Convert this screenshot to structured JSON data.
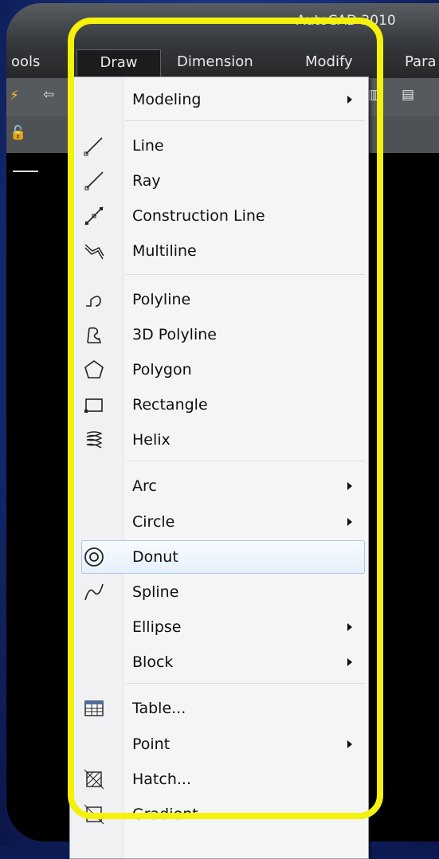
{
  "app": {
    "title": "AutoCAD 2010"
  },
  "menubar": {
    "items": [
      "ools",
      "Draw",
      "Dimension",
      "Modify",
      "Para"
    ],
    "open": "Draw"
  },
  "menu": {
    "items": [
      {
        "label": "Modeling",
        "submenu": true,
        "icon": ""
      },
      {
        "label": "Line",
        "submenu": false,
        "icon": "line-icon"
      },
      {
        "label": "Ray",
        "submenu": false,
        "icon": "ray-icon"
      },
      {
        "label": "Construction Line",
        "submenu": false,
        "icon": "construction-line-icon"
      },
      {
        "label": "Multiline",
        "submenu": false,
        "icon": "multiline-icon"
      },
      {
        "label": "Polyline",
        "submenu": false,
        "icon": "polyline-icon"
      },
      {
        "label": "3D Polyline",
        "submenu": false,
        "icon": "3d-polyline-icon"
      },
      {
        "label": "Polygon",
        "submenu": false,
        "icon": "polygon-icon"
      },
      {
        "label": "Rectangle",
        "submenu": false,
        "icon": "rectangle-icon"
      },
      {
        "label": "Helix",
        "submenu": false,
        "icon": "helix-icon"
      },
      {
        "label": "Arc",
        "submenu": true,
        "icon": ""
      },
      {
        "label": "Circle",
        "submenu": true,
        "icon": ""
      },
      {
        "label": "Donut",
        "submenu": false,
        "icon": "donut-icon",
        "highlighted": true
      },
      {
        "label": "Spline",
        "submenu": false,
        "icon": "spline-icon"
      },
      {
        "label": "Ellipse",
        "submenu": true,
        "icon": ""
      },
      {
        "label": "Block",
        "submenu": true,
        "icon": ""
      },
      {
        "label": "Table...",
        "submenu": false,
        "icon": "table-icon"
      },
      {
        "label": "Point",
        "submenu": true,
        "icon": ""
      },
      {
        "label": "Hatch...",
        "submenu": false,
        "icon": "hatch-icon"
      },
      {
        "label": "Gradient...",
        "submenu": false,
        "icon": "gradient-icon"
      }
    ]
  },
  "colors": {
    "highlight_frame": "#f4f10a",
    "menu_background": "#f5f5f6",
    "hover_border": "#a9c6ea"
  }
}
